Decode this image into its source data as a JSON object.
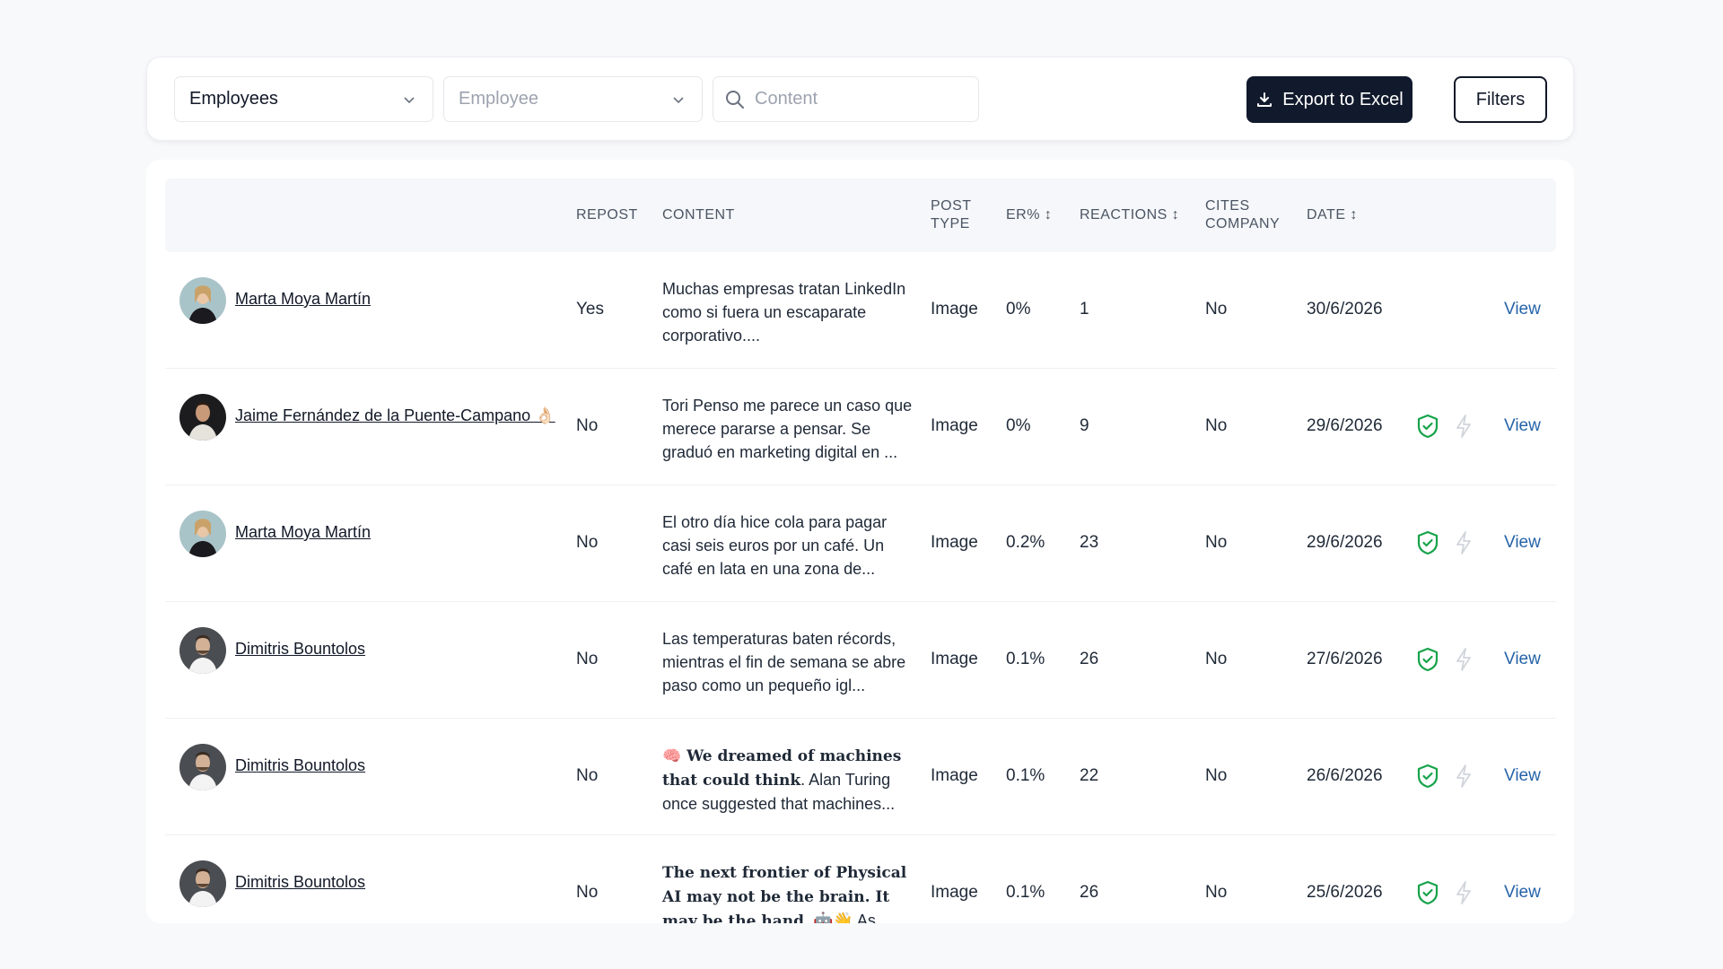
{
  "toolbar": {
    "employees_select": "Employees",
    "employee_placeholder": "Employee",
    "search_placeholder": "Content",
    "export_label": "Export to Excel",
    "filters_label": "Filters"
  },
  "table": {
    "headers": {
      "repost": "REPOST",
      "content": "CONTENT",
      "post_type_1": "POST",
      "post_type_2": "TYPE",
      "er": "ER% ↕",
      "reactions": "REACTIONS ↕",
      "cites_1": "CITES",
      "cites_2": "COMPANY",
      "date": "DATE ↕"
    },
    "rows": [
      {
        "name": "Marta Moya Martín",
        "repost": "Yes",
        "content": "Muchas empresas tratan LinkedIn como si fuera un escaparate corporativo....",
        "type": "Image",
        "er": "0%",
        "reactions": "1",
        "cites": "No",
        "date": "30/6/2026",
        "view": "View"
      },
      {
        "name": "Jaime Fernández de la Puente-Campano 👌🏻",
        "repost": "No",
        "content": "Tori Penso me parece un caso que merece pararse a pensar. Se graduó en marketing digital en ...",
        "type": "Image",
        "er": "0%",
        "reactions": "9",
        "cites": "No",
        "date": "29/6/2026",
        "view": "View"
      },
      {
        "name": "Marta Moya Martín",
        "repost": "No",
        "content": "El otro día hice cola para pagar casi seis euros por un café. Un café en lata en una zona de...",
        "type": "Image",
        "er": "0.2%",
        "reactions": "23",
        "cites": "No",
        "date": "29/6/2026",
        "view": "View"
      },
      {
        "name": "Dimitris Bountolos",
        "repost": "No",
        "content": "Las temperaturas baten récords, mientras el fin de semana se abre paso como un pequeño igl...",
        "type": "Image",
        "er": "0.1%",
        "reactions": "26",
        "cites": "No",
        "date": "27/6/2026",
        "view": "View"
      },
      {
        "name": "Dimitris Bountolos",
        "repost": "No",
        "content_bold": "🧠 We dreamed of machines that could think",
        "content_rest": ". Alan Turing once suggested that machines...",
        "type": "Image",
        "er": "0.1%",
        "reactions": "22",
        "cites": "No",
        "date": "26/6/2026",
        "view": "View"
      },
      {
        "name": "Dimitris Bountolos",
        "repost": "No",
        "content_bold": "The next frontier of Physical AI may not be the brain. It may be the hand",
        "content_rest": ". 🤖👋 As humanoid...",
        "type": "Image",
        "er": "0.1%",
        "reactions": "26",
        "cites": "No",
        "date": "25/6/2026",
        "view": "View"
      }
    ]
  },
  "colors": {
    "primary_button": "#111a2c",
    "link": "#2563a8",
    "shield_green": "#16a34a",
    "bolt_gray": "#d1d5db"
  },
  "icons": [
    "chevron-down-icon",
    "search-icon",
    "download-icon",
    "shield-check-icon",
    "bolt-icon",
    "avatar"
  ]
}
